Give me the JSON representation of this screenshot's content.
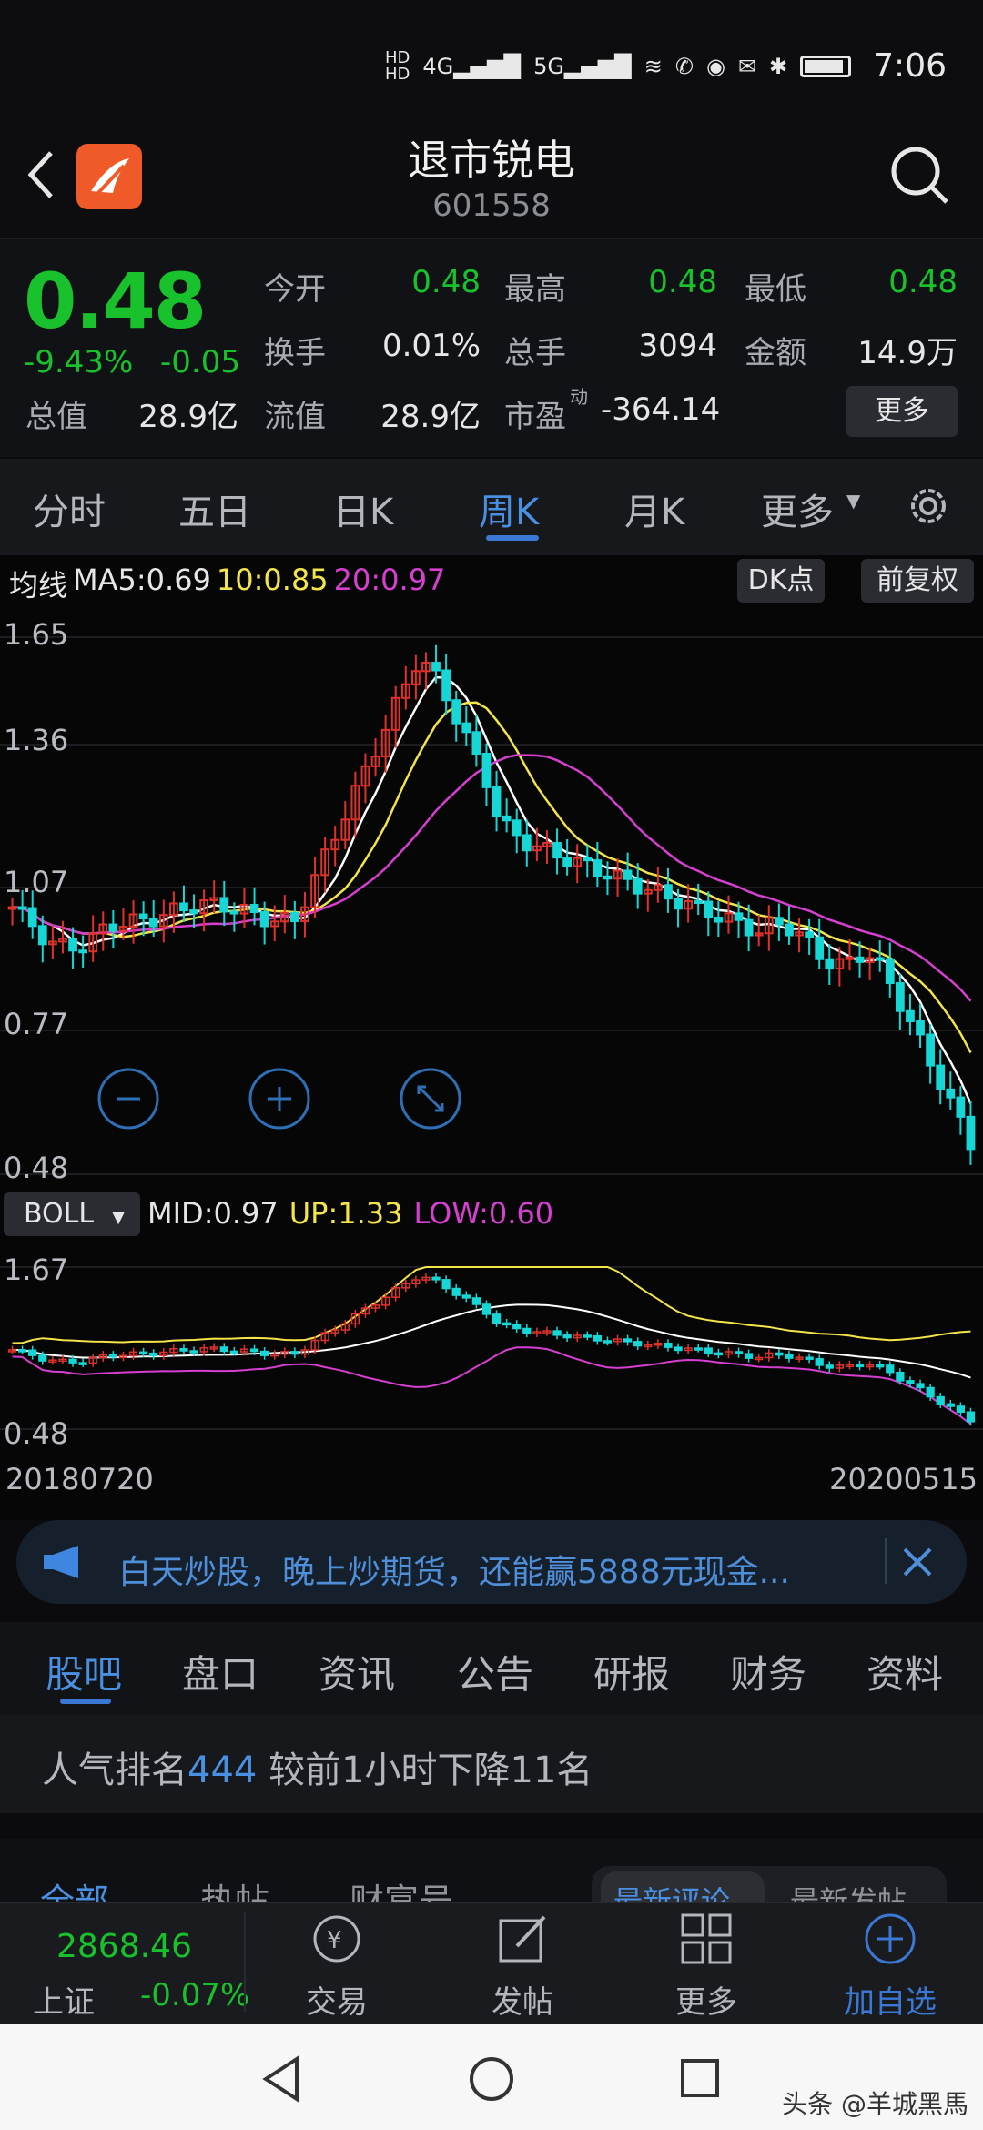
{
  "status_bar": {
    "time": "7:06",
    "network_labels": [
      "HD1",
      "HD2",
      "4G",
      "5G"
    ]
  },
  "header": {
    "title": "退市锐电",
    "code": "601558"
  },
  "quote": {
    "price": "0.48",
    "change_pct": "-9.43%",
    "change": "-0.05",
    "total_mv_label": "总值",
    "total_mv": "28.9亿",
    "float_mv_label": "流值",
    "float_mv": "28.9亿",
    "pe_label": "市盈",
    "pe_sup": "动",
    "pe": "-364.14",
    "open_label": "今开",
    "open": "0.48",
    "high_label": "最高",
    "high": "0.48",
    "low_label": "最低",
    "low": "0.48",
    "turnover_label": "换手",
    "turnover": "0.01%",
    "volume_label": "总手",
    "volume": "3094",
    "amount_label": "金额",
    "amount": "14.9万",
    "more_label": "更多"
  },
  "period_tabs": [
    "分时",
    "五日",
    "日K",
    "周K",
    "月K",
    "更多"
  ],
  "active_period": "周K",
  "ma_legend": {
    "prefix": "均线",
    "ma5": "MA5:0.69",
    "ma10": "10:0.85",
    "ma20": "20:0.97"
  },
  "chips": {
    "dk": "DK点",
    "adjust": "前复权"
  },
  "boll_legend": {
    "selector": "BOLL",
    "mid": "MID:0.97",
    "up": "UP:1.33",
    "low": "LOW:0.60"
  },
  "chart_data": {
    "type": "candlestick",
    "main_axis_labels": [
      "1.65",
      "1.36",
      "1.07",
      "0.77",
      "0.48"
    ],
    "boll_axis_labels": [
      "1.67",
      "0.48"
    ],
    "x_start": "20180720",
    "x_end": "20200515",
    "series": [
      {
        "name": "MA5",
        "last": 0.69
      },
      {
        "name": "MA10",
        "last": 0.85
      },
      {
        "name": "MA20",
        "last": 0.97
      }
    ]
  },
  "colors": {
    "up": "#e0322b",
    "down": "#17d6d6",
    "ma5": "#ffffff",
    "ma10": "#f3e44a",
    "ma20": "#d63fd0",
    "accent": "#4a90e2"
  },
  "banner": {
    "text": "白天炒股，晚上炒期货，还能赢5888元现金..."
  },
  "section_tabs": [
    "股吧",
    "盘口",
    "资讯",
    "公告",
    "研报",
    "财务",
    "资料"
  ],
  "active_section": "股吧",
  "rank": {
    "prefix": "人气排名",
    "number": "444",
    "suffix": " 较前1小时下降11名"
  },
  "sub_tabs": [
    "全部",
    "热帖",
    "财富号",
    "最新评论",
    "最新发帖"
  ],
  "bottom": {
    "index_value": "2868.46",
    "index_name": "上证",
    "index_change": "-0.07%",
    "items": [
      "交易",
      "发帖",
      "更多",
      "加自选"
    ]
  },
  "watermark": "头条 @羊城黑馬"
}
